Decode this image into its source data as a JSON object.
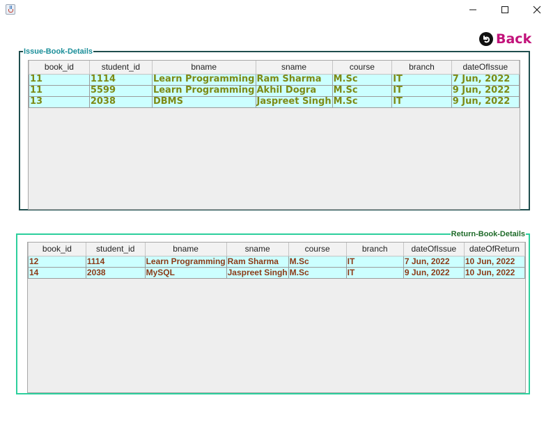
{
  "window": {
    "minimize_glyph": "—",
    "maximize_glyph": "☐",
    "close_glyph": "✕"
  },
  "back_button": {
    "label": "Back",
    "icon": "back-arrow-icon"
  },
  "issue_panel": {
    "title": "Issue-Book-Details",
    "columns": [
      "book_id",
      "student_id",
      "bname",
      "sname",
      "course",
      "branch",
      "dateOfIssue"
    ],
    "rows": [
      [
        "11",
        "1114",
        "Learn Programming",
        "Ram Sharma",
        "M.Sc",
        "IT",
        "7 Jun, 2022"
      ],
      [
        "11",
        "5599",
        "Learn Programming",
        "Akhil Dogra",
        "M.Sc",
        "IT",
        "9 Jun, 2022"
      ],
      [
        "13",
        "2038",
        "DBMS",
        "Jaspreet Singh",
        "M.Sc",
        "IT",
        "9 Jun, 2022"
      ]
    ]
  },
  "return_panel": {
    "title": "Return-Book-Details",
    "columns": [
      "book_id",
      "student_id",
      "bname",
      "sname",
      "course",
      "branch",
      "dateOfIssue",
      "dateOfReturn"
    ],
    "rows": [
      [
        "12",
        "1114",
        "Learn Programming",
        "Ram Sharma",
        "M.Sc",
        "IT",
        "7 Jun, 2022",
        "10 Jun, 2022"
      ],
      [
        "14",
        "2038",
        "MySQL",
        "Jaspreet Singh",
        "M.Sc",
        "IT",
        "9 Jun, 2022",
        "10 Jun, 2022"
      ]
    ]
  },
  "colors": {
    "issue_text": "#7d8a14",
    "return_text": "#8c3a17",
    "row_background": "#ccffff",
    "back_label": "#c2127a",
    "issue_border": "#1f4e4e",
    "return_border": "#2ccf9c"
  }
}
